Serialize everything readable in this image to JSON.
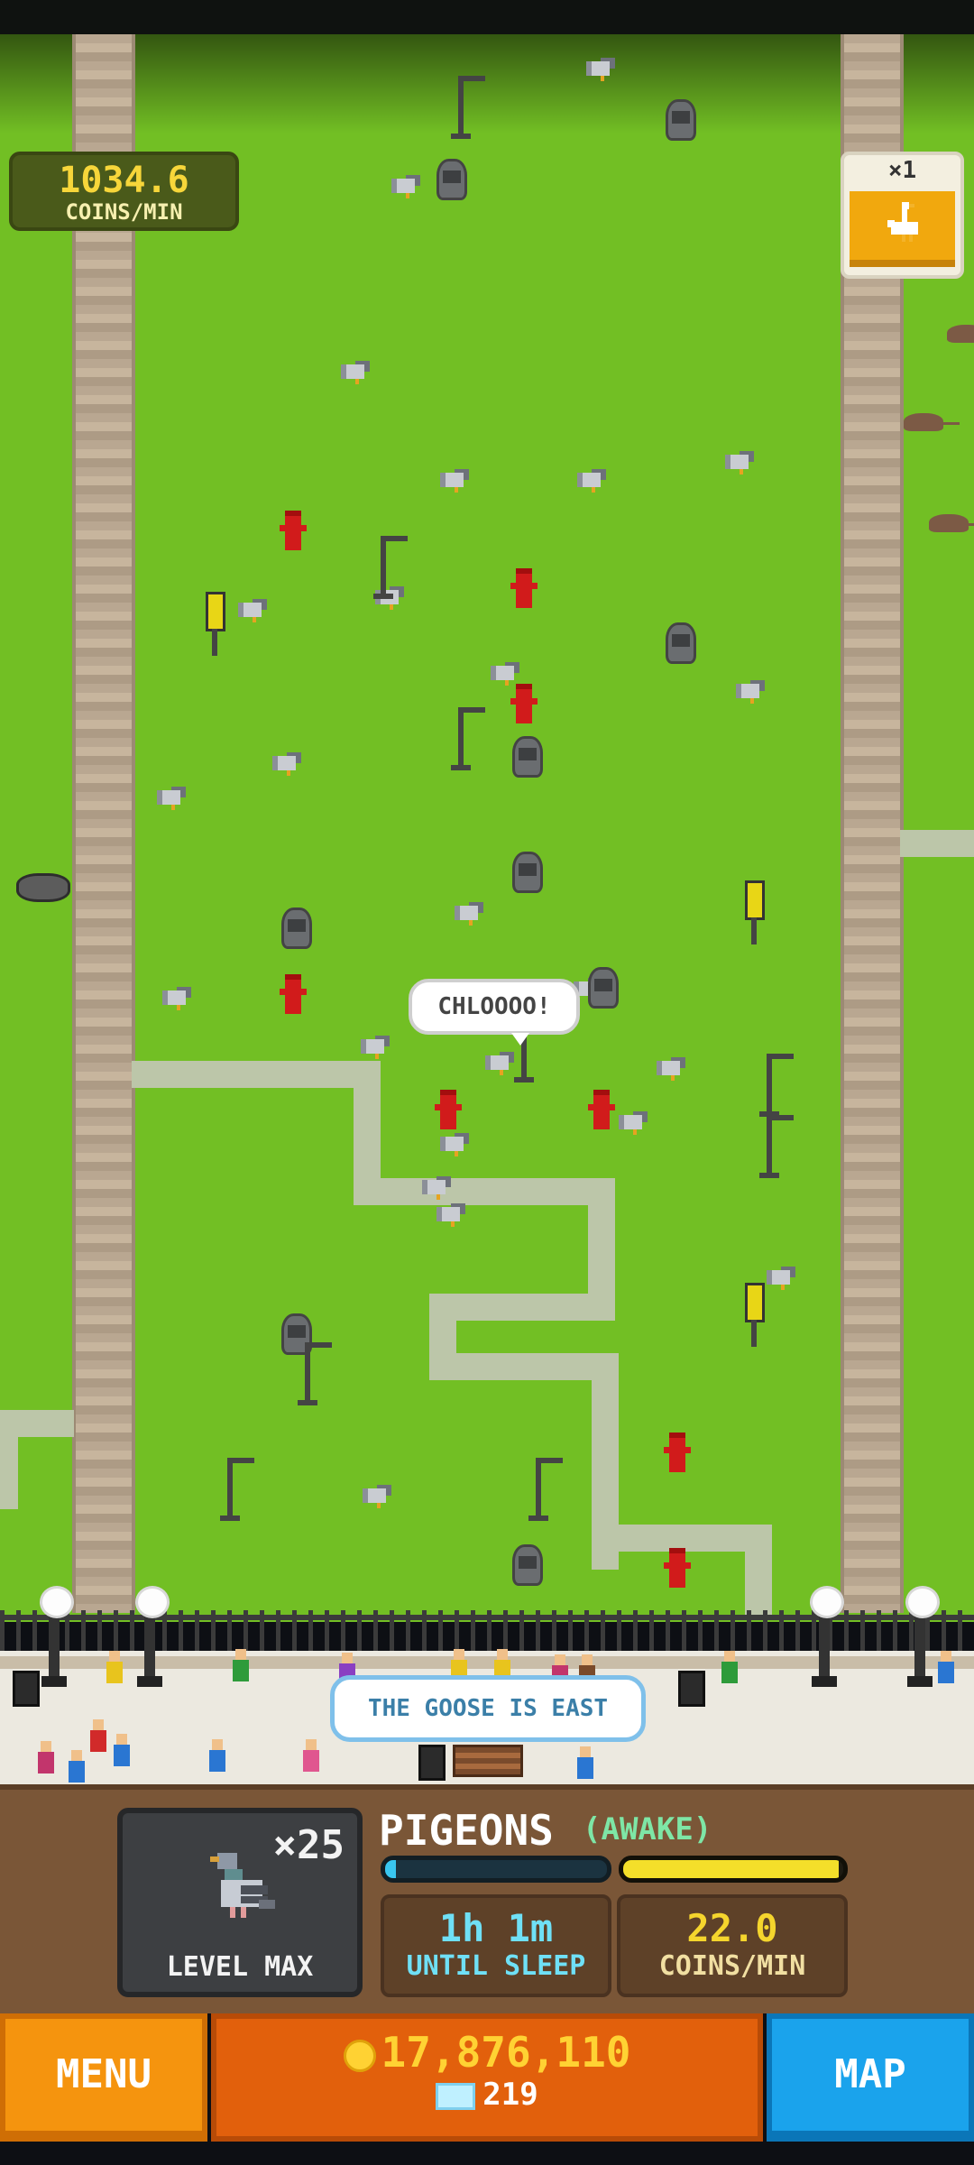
{
  "hud": {
    "rate_value": "1034.6",
    "rate_label": "COINS/MIN",
    "multiplier": "×1",
    "multiplier_icon": "goose-icon"
  },
  "world": {
    "speech_bubble": "CHLOOOO!",
    "hint": "THE GOOSE IS EAST"
  },
  "animal": {
    "name": "PIGEONS",
    "state": "(AWAKE)",
    "count": "×25",
    "level": "LEVEL MAX",
    "sleep_fraction": 0.05,
    "coin_fraction": 0.98,
    "time_value": "1h 1m",
    "time_label": "UNTIL SLEEP",
    "coins_value": "22.0",
    "coins_label": "COINS/MIN"
  },
  "bottom": {
    "menu_label": "MENU",
    "coins": "17,876,110",
    "gems": "219",
    "map_label": "MAP"
  },
  "colors": {
    "grass": "#72bf24",
    "panel": "#7a5637",
    "menu": "#f5940e",
    "wallet": "#e2600c",
    "map": "#1aa3ec"
  }
}
